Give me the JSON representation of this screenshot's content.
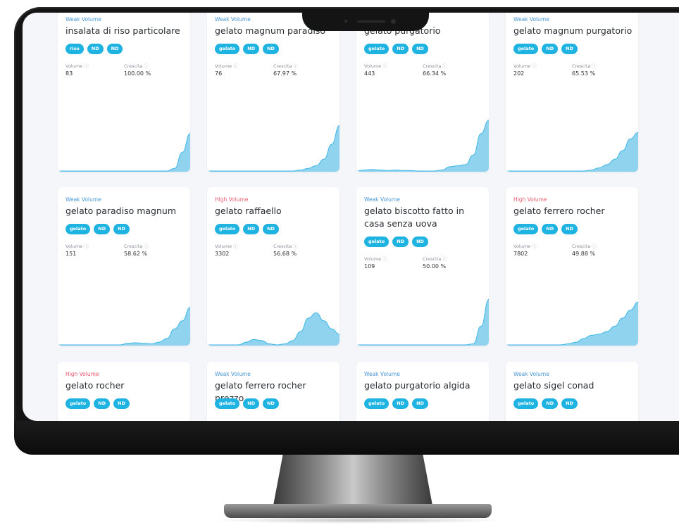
{
  "cards": [
    {
      "volume_type": "Weak Volume",
      "volume_class": "weak",
      "keyword": "insalata di riso particolare",
      "tags": [
        "riso",
        "ND",
        "ND"
      ],
      "volume_label": "Volume",
      "volume": "83",
      "growth_label": "Crescita",
      "growth": "100.00 %",
      "spark": [
        0,
        0,
        0,
        0,
        0,
        0,
        0,
        0,
        0,
        0,
        0,
        0,
        0,
        0,
        0,
        0.05,
        0.35,
        0.7
      ]
    },
    {
      "volume_type": "Weak Volume",
      "volume_class": "weak",
      "keyword": "gelato magnum paradiso",
      "tags": [
        "gelato",
        "ND",
        "ND"
      ],
      "volume_label": "Volume",
      "volume": "76",
      "growth_label": "Crescita",
      "growth": "67.97 %",
      "spark": [
        0,
        0,
        0,
        0,
        0,
        0,
        0,
        0,
        0,
        0,
        0,
        0,
        0.02,
        0.05,
        0.1,
        0.22,
        0.5,
        0.85
      ]
    },
    {
      "volume_type": "Weak Volume",
      "volume_class": "weak",
      "keyword": "gelato purgatorio",
      "tags": [
        "gelato",
        "ND",
        "ND"
      ],
      "volume_label": "Volume",
      "volume": "443",
      "growth_label": "Crescita",
      "growth": "66.34 %",
      "spark": [
        0,
        0.02,
        0.03,
        0.02,
        0.01,
        0.02,
        0.01,
        0.01,
        0,
        0,
        0,
        0.02,
        0.08,
        0.1,
        0.12,
        0.3,
        0.7,
        0.95
      ]
    },
    {
      "volume_type": "Weak Volume",
      "volume_class": "weak",
      "keyword": "gelato magnum purgatorio",
      "tags": [
        "gelato",
        "ND",
        "ND"
      ],
      "volume_label": "Volume",
      "volume": "202",
      "growth_label": "Crescita",
      "growth": "65.53 %",
      "spark": [
        0,
        0,
        0,
        0,
        0,
        0,
        0,
        0,
        0,
        0,
        0,
        0.02,
        0.06,
        0.12,
        0.22,
        0.38,
        0.6,
        0.72
      ]
    },
    {
      "volume_type": "Weak Volume",
      "volume_class": "weak",
      "keyword": "gelato paradiso magnum",
      "tags": [
        "gelato",
        "ND",
        "ND"
      ],
      "volume_label": "Volume",
      "volume": "151",
      "growth_label": "Crescita",
      "growth": "58.62 %",
      "spark": [
        0,
        0,
        0,
        0,
        0,
        0,
        0,
        0,
        0,
        0.03,
        0.04,
        0.03,
        0.02,
        0.05,
        0.12,
        0.3,
        0.45,
        0.7
      ]
    },
    {
      "volume_type": "High Volume",
      "volume_class": "high",
      "keyword": "gelato raffaello",
      "tags": [
        "gelato",
        "ND",
        "ND"
      ],
      "volume_label": "Volume",
      "volume": "3302",
      "growth_label": "Crescita",
      "growth": "56.68 %",
      "spark": [
        0,
        0,
        0,
        0,
        0,
        0.05,
        0.1,
        0.08,
        0.02,
        0,
        0.02,
        0.08,
        0.25,
        0.5,
        0.6,
        0.45,
        0.3,
        0.2
      ]
    },
    {
      "volume_type": "Weak Volume",
      "volume_class": "weak",
      "keyword": "gelato biscotto fatto in casa senza uova",
      "tags": [
        "gelato",
        "ND",
        "ND"
      ],
      "volume_label": "Volume",
      "volume": "109",
      "growth_label": "Crescita",
      "growth": "50.00 %",
      "spark": [
        0,
        0,
        0,
        0,
        0,
        0,
        0,
        0,
        0,
        0,
        0,
        0,
        0,
        0,
        0,
        0.02,
        0.35,
        0.85
      ]
    },
    {
      "volume_type": "High Volume",
      "volume_class": "high",
      "keyword": "gelato ferrero rocher",
      "tags": [
        "gelato",
        "ND",
        "ND"
      ],
      "volume_label": "Volume",
      "volume": "7802",
      "growth_label": "Crescita",
      "growth": "49.88 %",
      "spark": [
        0,
        0,
        0,
        0,
        0,
        0,
        0,
        0,
        0.02,
        0.05,
        0.12,
        0.18,
        0.2,
        0.25,
        0.35,
        0.5,
        0.65,
        0.8
      ]
    },
    {
      "volume_type": "High Volume",
      "volume_class": "high",
      "keyword": "gelato rocher",
      "tags": [
        "gelato",
        "ND",
        "ND"
      ],
      "volume_label": "Volume",
      "volume": "",
      "growth_label": "Crescita",
      "growth": "",
      "spark": []
    },
    {
      "volume_type": "Weak Volume",
      "volume_class": "weak",
      "keyword": "gelato ferrero rocher prezzo",
      "tags": [
        "gelato",
        "ND",
        "ND"
      ],
      "volume_label": "Volume",
      "volume": "",
      "growth_label": "Crescita",
      "growth": "",
      "spark": []
    },
    {
      "volume_type": "Weak Volume",
      "volume_class": "weak",
      "keyword": "gelato purgatorio algida",
      "tags": [
        "gelato",
        "ND",
        "ND"
      ],
      "volume_label": "Volume",
      "volume": "",
      "growth_label": "Crescita",
      "growth": "",
      "spark": []
    },
    {
      "volume_type": "Weak Volume",
      "volume_class": "weak",
      "keyword": "gelato sigel conad",
      "tags": [
        "gelato",
        "ND",
        "ND"
      ],
      "volume_label": "Volume",
      "volume": "",
      "growth_label": "Crescita",
      "growth": "",
      "spark": []
    }
  ],
  "colors": {
    "weak": "#4a98d4",
    "high": "#ec5a6e",
    "tag": "#1fb3e2",
    "spark_fill": "#8fd3ef",
    "spark_line": "#3fb6e6"
  }
}
